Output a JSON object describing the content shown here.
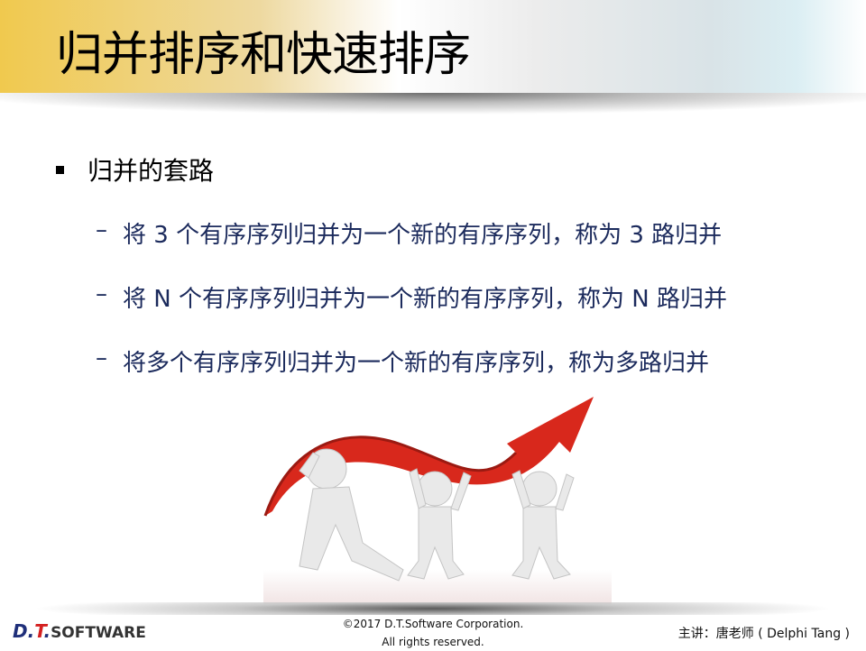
{
  "slide": {
    "title": "归并排序和快速排序",
    "bullet": "归并的套路",
    "sub_items": [
      "将 3 个有序序列归并为一个新的有序序列，称为 3 路归并",
      "将 N 个有序序列归并为一个新的有序序列，称为 N 路归并",
      "将多个有序序列归并为一个新的有序序列，称为多路归并"
    ],
    "dash": "–"
  },
  "footer": {
    "logo": "D.T.SOFTWARE",
    "logo_parts": [
      "D.",
      "T",
      ".",
      "SOFTWARE"
    ],
    "copyright_line1": "©2017 D.T.Software Corporation.",
    "copyright_line2": "All rights reserved.",
    "presenter": "主讲：唐老师 ( Delphi Tang )"
  },
  "colors": {
    "accent": "#f0c94e",
    "subtext": "#1b2a5c",
    "arrow": "#d8281c"
  }
}
